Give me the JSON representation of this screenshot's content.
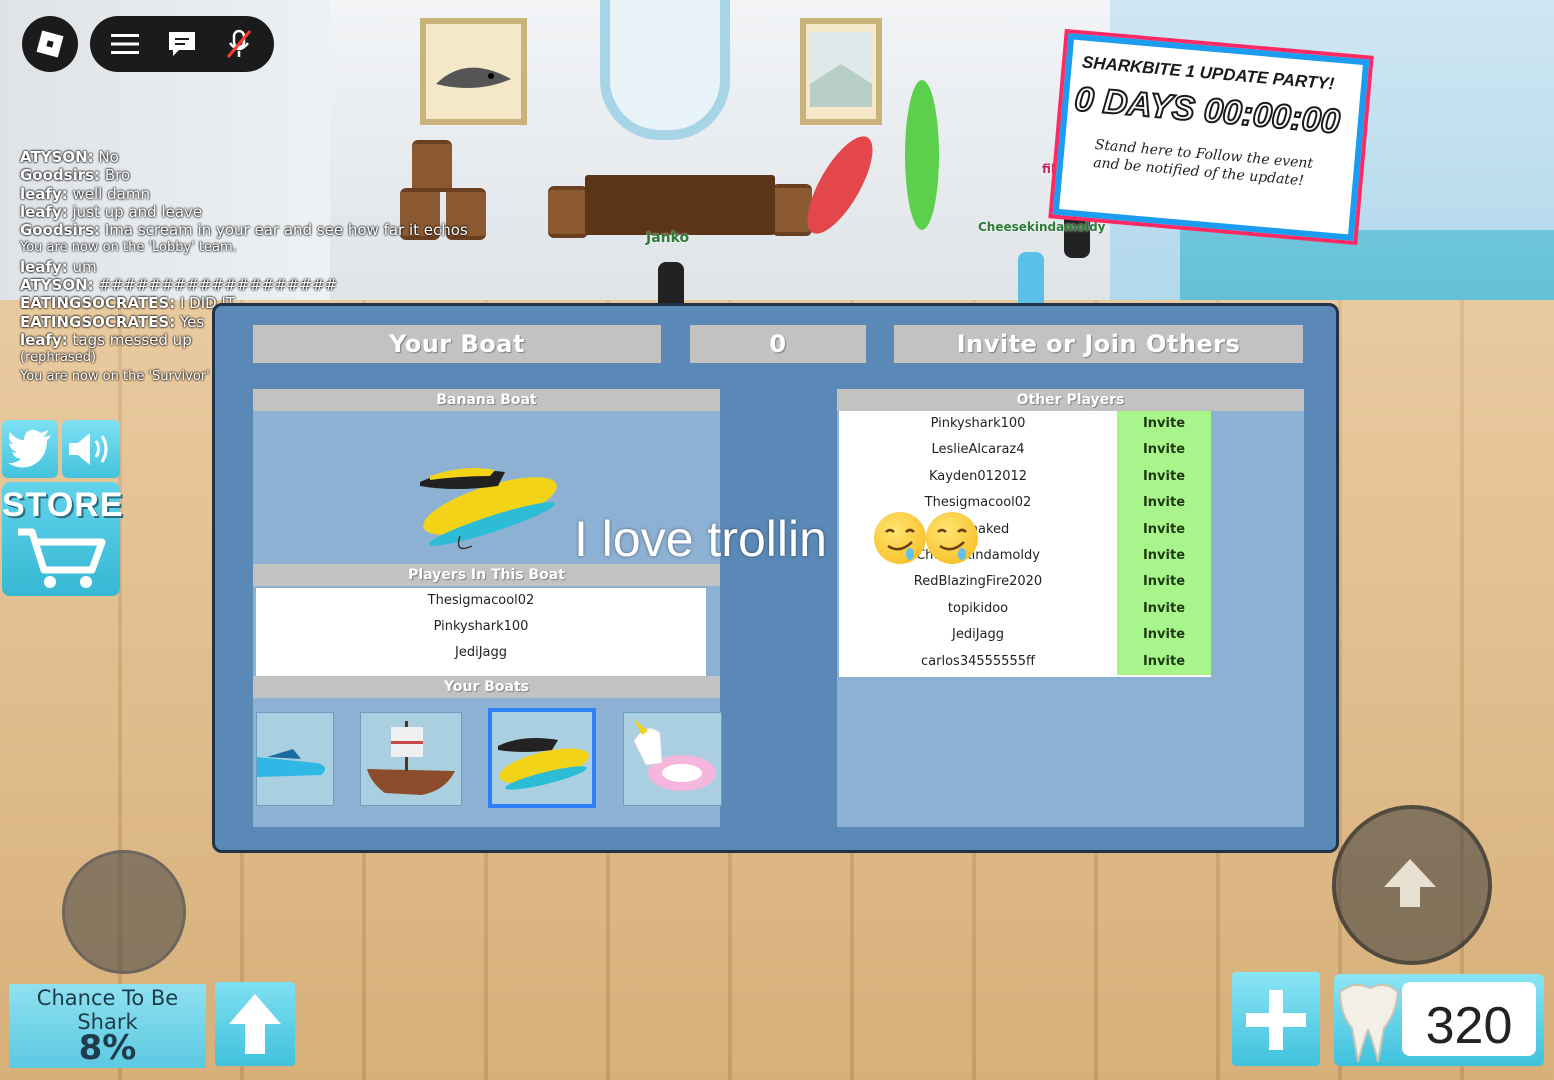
{
  "topbar": {
    "menu_icon": "hamburger-icon",
    "chat_icon": "chat-icon",
    "mic_icon": "mic-muted-icon"
  },
  "chat": {
    "lines": [
      {
        "name": "ATYSON:",
        "text": " No"
      },
      {
        "name": "Goodsirs:",
        "text": " Bro"
      },
      {
        "name": "leafy:",
        "text": " well damn"
      },
      {
        "name": "leafy:",
        "text": " just up and leave"
      },
      {
        "name": "Goodsirs:",
        "text": " Ima scream in your ear and see how far it echos"
      },
      {
        "name": "",
        "text": "You are now on the 'Lobby' team."
      },
      {
        "name": "leafy:",
        "text": " um"
      },
      {
        "name": "ATYSON:",
        "text": " ###################"
      },
      {
        "name": "EATINGSOCRATES:",
        "text": " I DID IT"
      },
      {
        "name": "EATINGSOCRATES:",
        "text": " Yes"
      },
      {
        "name": "leafy:",
        "text": " tags messed up"
      },
      {
        "name": "",
        "text": "(rephrased)"
      },
      {
        "name": "",
        "text": "You are now on the 'Survivor' team."
      }
    ]
  },
  "side": {
    "store_label": "STORE",
    "twitter_icon": "twitter-icon",
    "sound_icon": "speaker-icon",
    "cart_icon": "cart-icon"
  },
  "billboard": {
    "title": "SHARKBITE 1 UPDATE PARTY!",
    "countdown": "0 DAYS 00:00:00",
    "note": "Stand here to Follow the event and be notified of the update!"
  },
  "nametags": {
    "janko": "Janko",
    "filly": "fillysuper2018",
    "cheese": "Cheesekindamoldy"
  },
  "dialog": {
    "your_boat_label": "Your Boat",
    "count": "0",
    "invite_label": "Invite or Join Others",
    "boat_name": "Banana Boat",
    "players_header": "Players In This Boat",
    "players": [
      "Thesigmacool02",
      "Pinkyshark100",
      "JediJagg"
    ],
    "your_boats_header": "Your Boats",
    "boats": [
      "Speed Boat",
      "Pirate Ship",
      "Banana Boat",
      "Unicorn Float"
    ],
    "other_players_header": "Other Players",
    "invite_button": "Invite",
    "other_players": [
      "Pinkyshark100",
      "LeslieAlcaraz4",
      "Kayden012012",
      "Thesigmacool02",
      "Dothaked",
      "Cheesekindamoldy",
      "RedBlazingFire2020",
      "topikidoo",
      "JediJagg",
      "carlos34555555ff"
    ]
  },
  "overlay_text": "I love trollin",
  "hud": {
    "chance_label": "Chance To Be Shark",
    "chance_value": "8%",
    "teeth": "320",
    "plus_icon": "plus-icon",
    "tooth_icon": "tooth-icon",
    "up_icon": "arrow-up-icon",
    "jump_icon": "jump-arrow-icon"
  },
  "colors": {
    "dialog_bg": "#5b89b7",
    "invite_green": "#a8f58c",
    "header_gray": "#c2c2c2",
    "hud_cyan": "#5cc9e2"
  }
}
